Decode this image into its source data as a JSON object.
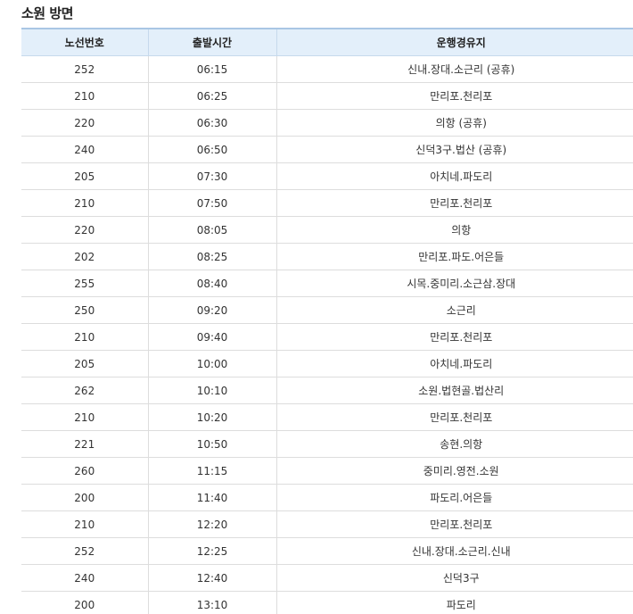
{
  "page": {
    "title": "소원 방면"
  },
  "table": {
    "headers": [
      "노선번호",
      "출발시간",
      "운행경유지"
    ],
    "rows": [
      [
        "252",
        "06:15",
        "신내.장대.소근리 (공휴)"
      ],
      [
        "210",
        "06:25",
        "만리포.천리포"
      ],
      [
        "220",
        "06:30",
        "의항 (공휴)"
      ],
      [
        "240",
        "06:50",
        "신덕3구.법산 (공휴)"
      ],
      [
        "205",
        "07:30",
        "아치네.파도리"
      ],
      [
        "210",
        "07:50",
        "만리포.천리포"
      ],
      [
        "220",
        "08:05",
        "의항"
      ],
      [
        "202",
        "08:25",
        "만리포.파도.어은들"
      ],
      [
        "255",
        "08:40",
        "시목.중미리.소근삼.장대"
      ],
      [
        "250",
        "09:20",
        "소근리"
      ],
      [
        "210",
        "09:40",
        "만리포.천리포"
      ],
      [
        "205",
        "10:00",
        "아치네.파도리"
      ],
      [
        "262",
        "10:10",
        "소원.법현골.법산리"
      ],
      [
        "210",
        "10:20",
        "만리포.천리포"
      ],
      [
        "221",
        "10:50",
        "송현.의항"
      ],
      [
        "260",
        "11:15",
        "중미리.영전.소원"
      ],
      [
        "200",
        "11:40",
        "파도리.어은들"
      ],
      [
        "210",
        "12:20",
        "만리포.천리포"
      ],
      [
        "252",
        "12:25",
        "신내.장대.소근리.신내"
      ],
      [
        "240",
        "12:40",
        "신덕3구"
      ],
      [
        "200",
        "13:10",
        "파도리"
      ]
    ]
  }
}
